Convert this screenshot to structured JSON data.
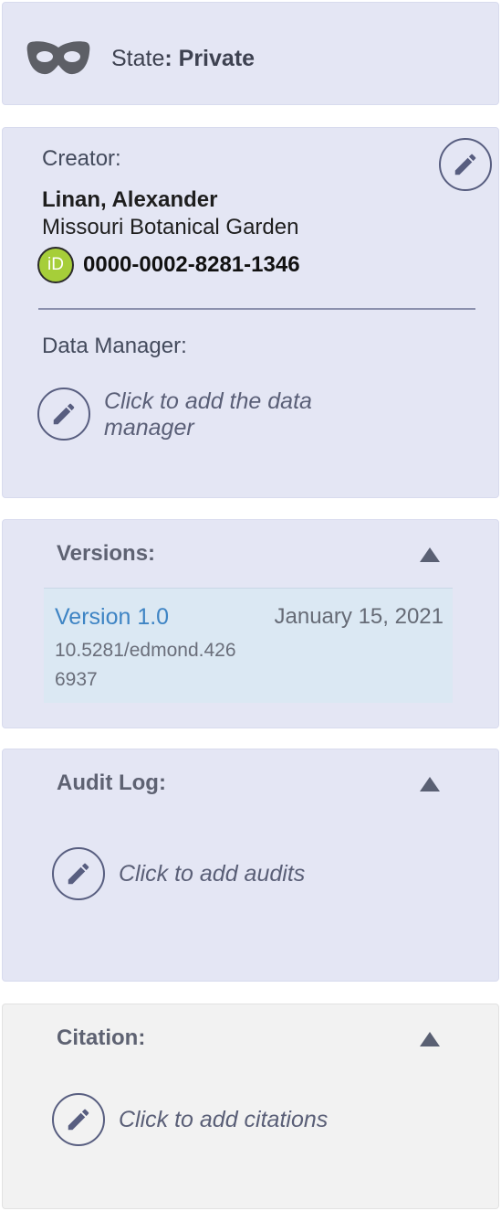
{
  "state": {
    "label": "State",
    "separator": ": ",
    "value": "Private",
    "icon": "mask-icon"
  },
  "creator": {
    "label": "Creator:",
    "name": "Linan, Alexander",
    "organization": "Missouri Botanical Garden",
    "orcid_badge": "iD",
    "orcid": "0000-0002-8281-1346"
  },
  "data_manager": {
    "label": "Data Manager:",
    "hint_line1": "Click to add the data",
    "hint_line2": "manager"
  },
  "versions": {
    "title": "Versions:",
    "items": [
      {
        "name": "Version 1.0",
        "date": "January 15, 2021",
        "doi_line1": "10.5281/edmond.426",
        "doi_line2": "6937"
      }
    ]
  },
  "audit_log": {
    "title": "Audit Log:",
    "hint": "Click to add audits"
  },
  "citation": {
    "title": "Citation:",
    "hint": "Click to add citations"
  },
  "colors": {
    "panel": "#e4e6f4",
    "panel_grey": "#f2f2f2",
    "link": "#3e84c4",
    "orcid_green": "#a6ce39"
  }
}
